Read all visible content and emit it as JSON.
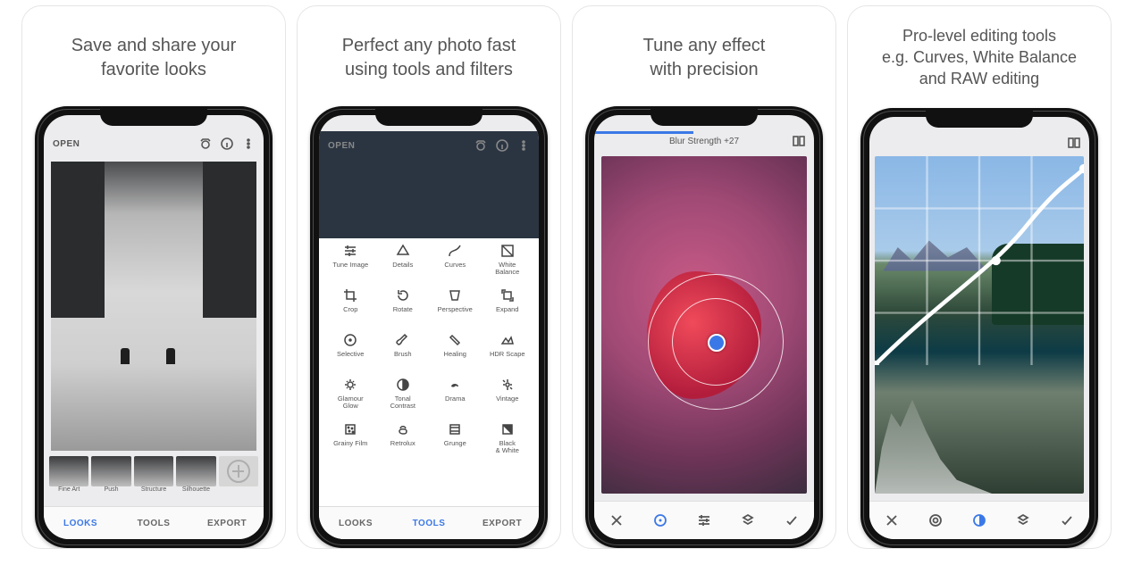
{
  "cards": [
    {
      "caption": "Save and share your\nfavorite looks"
    },
    {
      "caption": "Perfect any photo fast\nusing tools and filters"
    },
    {
      "caption": "Tune any effect\nwith precision"
    },
    {
      "caption": "Pro-level editing tools\ne.g. Curves, White Balance\nand RAW editing"
    }
  ],
  "topbar": {
    "open": "OPEN"
  },
  "footer": {
    "looks": "LOOKS",
    "tools": "TOOLS",
    "export": "EXPORT"
  },
  "screen1": {
    "filters": [
      "Fine Art",
      "Push",
      "Structure",
      "Silhouette"
    ]
  },
  "screen2": {
    "tools": [
      "Tune Image",
      "Details",
      "Curves",
      "White\nBalance",
      "Crop",
      "Rotate",
      "Perspective",
      "Expand",
      "Selective",
      "Brush",
      "Healing",
      "HDR Scape",
      "Glamour\nGlow",
      "Tonal\nContrast",
      "Drama",
      "Vintage",
      "Grainy Film",
      "Retrolux",
      "Grunge",
      "Black\n& White"
    ]
  },
  "screen3": {
    "label": "Blur Strength",
    "value": "+27"
  },
  "colors": {
    "accent": "#3b78e7"
  }
}
